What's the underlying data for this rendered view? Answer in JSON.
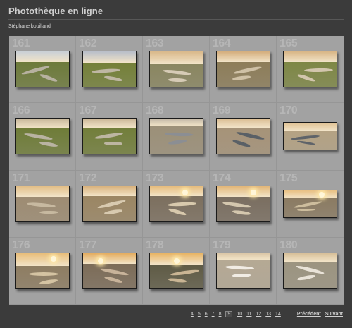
{
  "header": {
    "title": "Photothèque en ligne",
    "author": "Stéphane bouilland"
  },
  "gallery": {
    "items": [
      {
        "num": "161",
        "icon": "photo-thumbnail",
        "sky": "#c9cfd6",
        "land": "#6d7a3a",
        "river": "#b7b1a0"
      },
      {
        "num": "162",
        "icon": "photo-thumbnail",
        "sky": "#b8bec9",
        "land": "#748038",
        "river": "#bfb7a4"
      },
      {
        "num": "163",
        "icon": "photo-thumbnail",
        "sky": "#d9b88a",
        "land": "#8a8660",
        "river": "#d6cbb6"
      },
      {
        "num": "164",
        "icon": "photo-thumbnail",
        "sky": "#d4ad7b",
        "land": "#8d7d59",
        "river": "#cfc1a6"
      },
      {
        "num": "165",
        "icon": "photo-thumbnail",
        "sky": "#d8b585",
        "land": "#7e8745",
        "river": "#d2c6ad"
      },
      {
        "num": "166",
        "icon": "photo-thumbnail",
        "sky": "#c7b79a",
        "land": "#6f7c38",
        "river": "#b9b3a2"
      },
      {
        "num": "167",
        "icon": "photo-thumbnail",
        "sky": "#cbb697",
        "land": "#727e3a",
        "river": "#bdb6a2"
      },
      {
        "num": "168",
        "icon": "photo-thumbnail",
        "sky": "#c2b7a6",
        "land": "#9c9078",
        "river": "#8b8e93"
      },
      {
        "num": "169",
        "icon": "photo-thumbnail",
        "sky": "#dabd92",
        "land": "#a69378",
        "river": "#5a6066"
      },
      {
        "num": "170",
        "icon": "photo-thumbnail",
        "sky": "#e0c294",
        "land": "#b4a283",
        "river": "#5e6369"
      },
      {
        "num": "171",
        "icon": "photo-thumbnail",
        "sky": "#e2be86",
        "land": "#9e8c72",
        "river": "#c7b9a0"
      },
      {
        "num": "172",
        "icon": "photo-thumbnail",
        "sky": "#d9b27c",
        "land": "#9b8663",
        "river": "#d8cab0"
      },
      {
        "num": "173",
        "icon": "photo-thumbnail",
        "sky": "#e6bc7c",
        "land": "#7c6f5e",
        "river": "#d8c9ad"
      },
      {
        "num": "174",
        "icon": "photo-thumbnail",
        "sky": "#e2b677",
        "land": "#7a6e60",
        "river": "#d4c7ae"
      },
      {
        "num": "175",
        "icon": "photo-thumbnail",
        "sky": "#e8c083",
        "land": "#8b7b62",
        "river": "#cdbd9d"
      },
      {
        "num": "176",
        "icon": "photo-thumbnail",
        "sky": "#e8bd79",
        "land": "#8e7d62",
        "river": "#d4c3a2"
      },
      {
        "num": "177",
        "icon": "photo-thumbnail",
        "sky": "#e4ac5f",
        "land": "#7c6c58",
        "river": "#c8b39a"
      },
      {
        "num": "178",
        "icon": "photo-thumbnail",
        "sky": "#e8b463",
        "land": "#5f5b45",
        "river": "#c9b594"
      },
      {
        "num": "179",
        "icon": "photo-thumbnail",
        "sky": "#dbc6a6",
        "land": "#b5a994",
        "river": "#f1ece4"
      },
      {
        "num": "180",
        "icon": "photo-thumbnail",
        "sky": "#d7bf98",
        "land": "#9c9480",
        "river": "#e9e3d8"
      }
    ]
  },
  "pagination": {
    "pages": [
      "4",
      "5",
      "6",
      "7",
      "8",
      "9",
      "10",
      "11",
      "12",
      "13",
      "14"
    ],
    "current": "9",
    "prev_label": "Précédent",
    "next_label": "Suivant"
  }
}
